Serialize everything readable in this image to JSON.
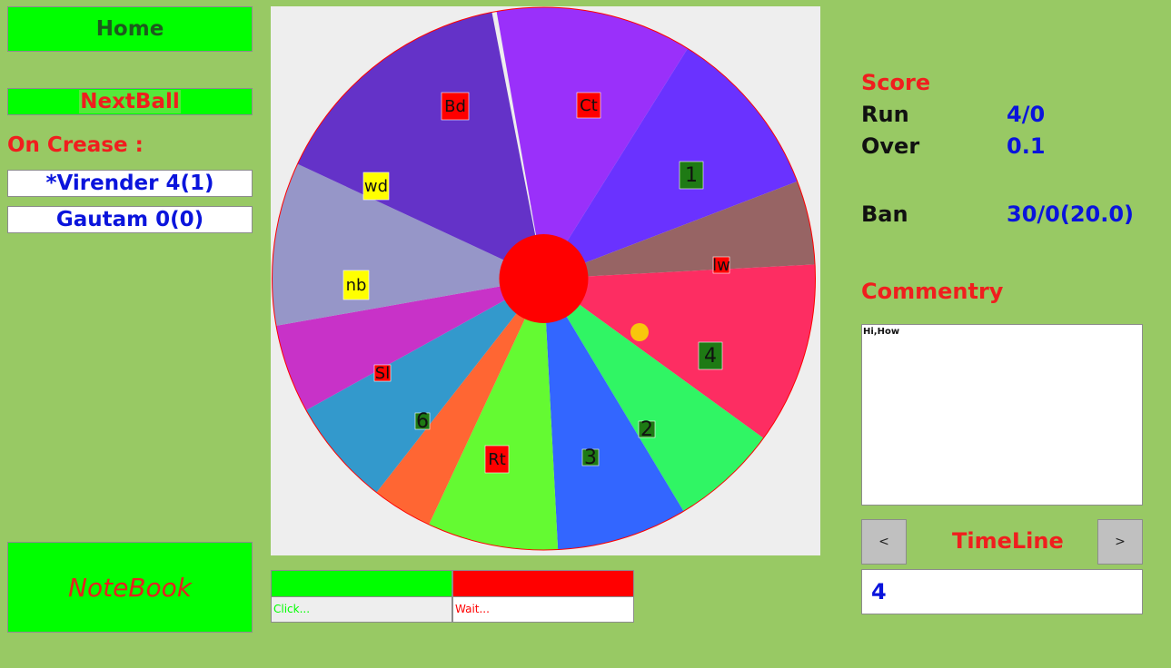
{
  "left_panel": {
    "home_label": "Home",
    "nextball_label": "NextBall",
    "on_crease_label": "On Crease :",
    "batters": [
      "*Virender 4(1)",
      "Gautam 0(0)"
    ],
    "notebook_label": "NoteBook"
  },
  "wheel": {
    "hub_color": "#ff0000",
    "ball_color": "#f8c60c",
    "segments": [
      {
        "label": "Ct",
        "color": "#9a30fa",
        "label_bg": "#ff0000"
      },
      {
        "label": "1",
        "color": "#6a32ff",
        "label_bg": "#1e7a14"
      },
      {
        "label": "lw",
        "color": "#976464",
        "label_bg": "#ff0000"
      },
      {
        "label": "4",
        "color": "#fd2d62",
        "label_bg": "#1e7a14"
      },
      {
        "label": "2",
        "color": "#30f564",
        "label_bg": "#1e7a14"
      },
      {
        "label": "3",
        "color": "#3366ff",
        "label_bg": "#1e7a14"
      },
      {
        "label": "Rt",
        "color": "#64fa32",
        "label_bg": "#ff0000"
      },
      {
        "label": "6",
        "color": "#ff6633",
        "label_bg": "#1e7a14"
      },
      {
        "label": "Sl",
        "color": "#3399cc",
        "label_bg": "#ff0000"
      },
      {
        "label": "nb",
        "color": "#c832c8",
        "label_bg": "#ffff00"
      },
      {
        "label": "wd",
        "color": "#9696c8",
        "label_bg": "#ffff00"
      },
      {
        "label": "Bd",
        "color": "#6432c8",
        "label_bg": "#ff0000"
      }
    ]
  },
  "status_bars": {
    "click": {
      "text": "Click...",
      "color": "#00ff00"
    },
    "wait": {
      "text": "Wait...",
      "color": "#ff0000"
    }
  },
  "scoreboard": {
    "score_label": "Score",
    "run_label": "Run",
    "run_value": "4/0",
    "over_label": "Over",
    "over_value": "0.1",
    "team_label": "Ban",
    "team_value": "30/0(20.0)"
  },
  "commentary": {
    "label": "Commentry",
    "text": "Hi,How"
  },
  "timeline": {
    "label": "TimeLine",
    "prev_label": "<",
    "next_label": ">",
    "value": "4"
  }
}
